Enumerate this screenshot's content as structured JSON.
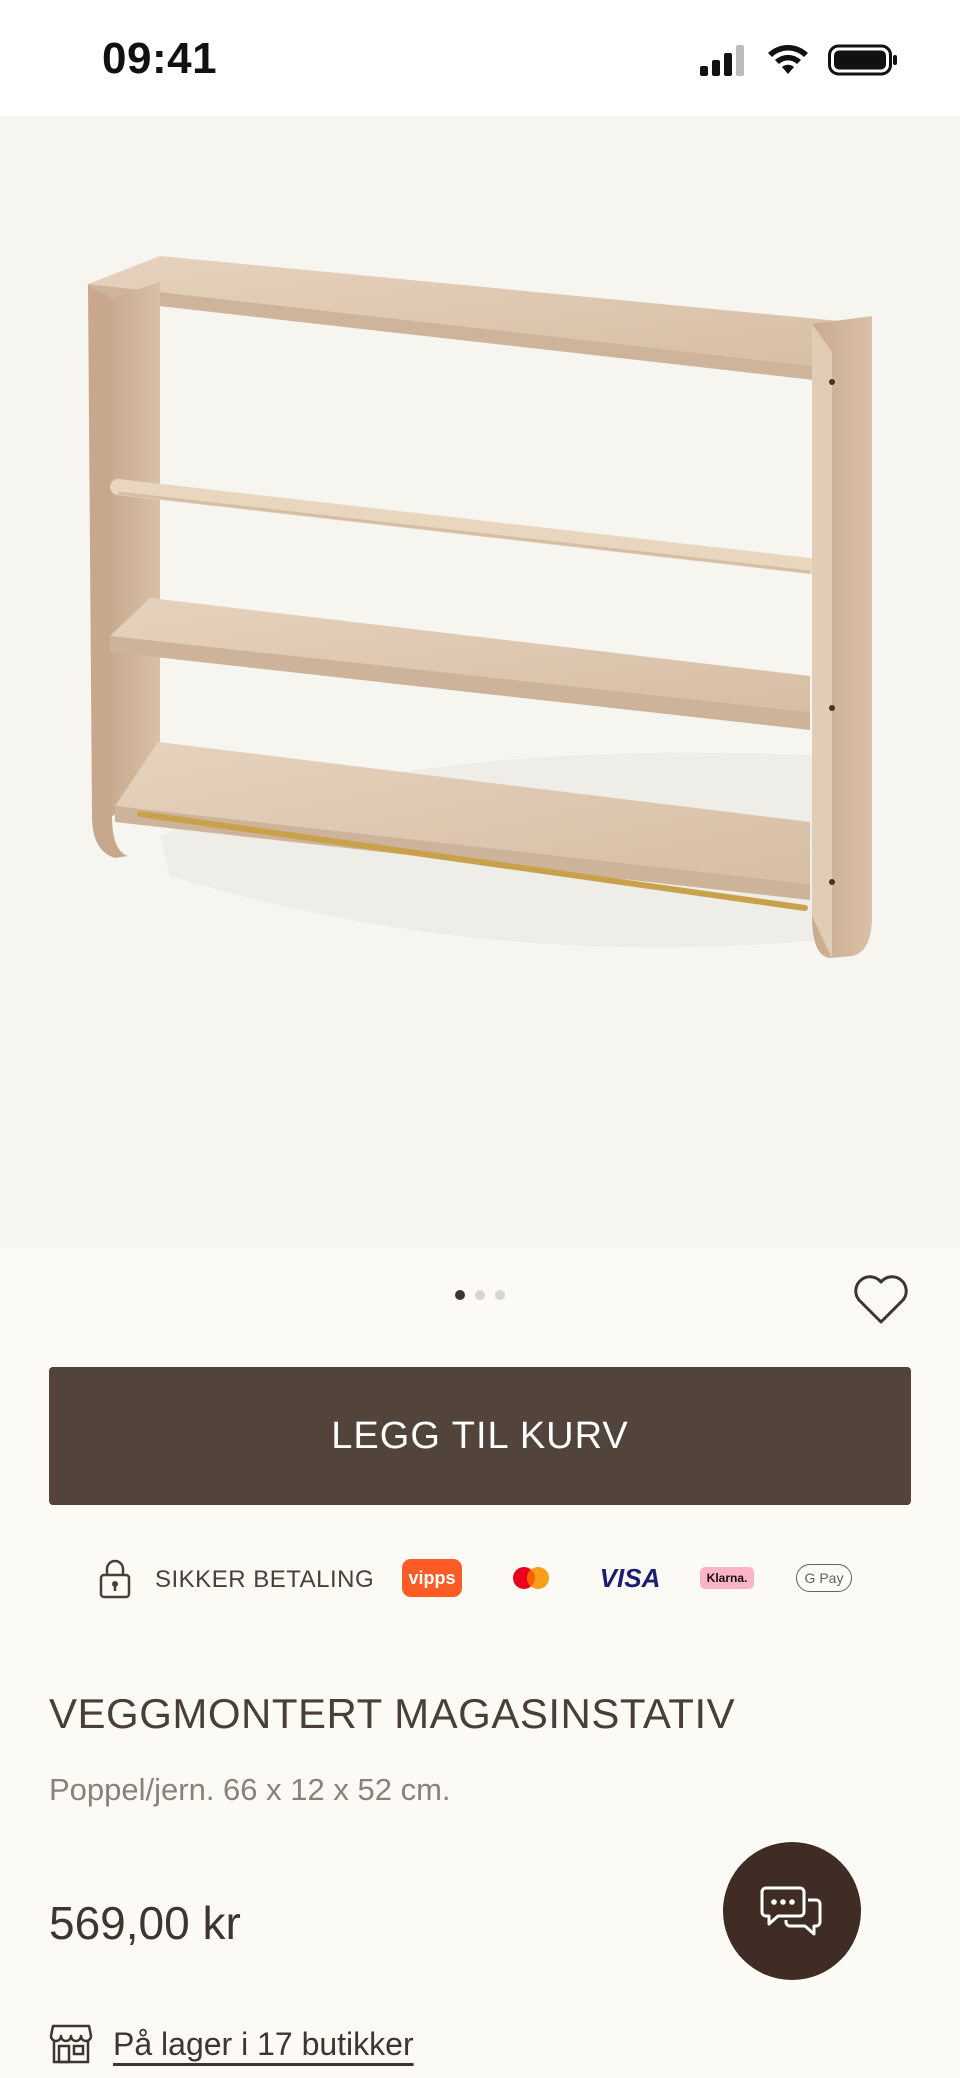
{
  "status_bar": {
    "time": "09:41"
  },
  "carousel": {
    "dot_count": 3,
    "active_index": 0
  },
  "cart": {
    "add_label": "LEGG TIL KURV"
  },
  "payment": {
    "secure_label": "SIKKER BETALING",
    "methods": [
      "Vipps",
      "Mastercard",
      "VISA",
      "Klarna",
      "G Pay"
    ],
    "vipps_text": "vipps",
    "visa_text": "VISA",
    "klarna_text": "Klarna.",
    "gpay_text": "G Pay"
  },
  "product": {
    "title": "VEGGMONTERT MAGASINSTATIV",
    "description": "Poppel/jern. 66 x 12 x 52 cm.",
    "price": "569,00 kr",
    "stock_link": "På lager i 17 butikker"
  },
  "colors": {
    "primary": "#52433b",
    "background": "#fbfaf5",
    "chat": "#3e2c25"
  }
}
